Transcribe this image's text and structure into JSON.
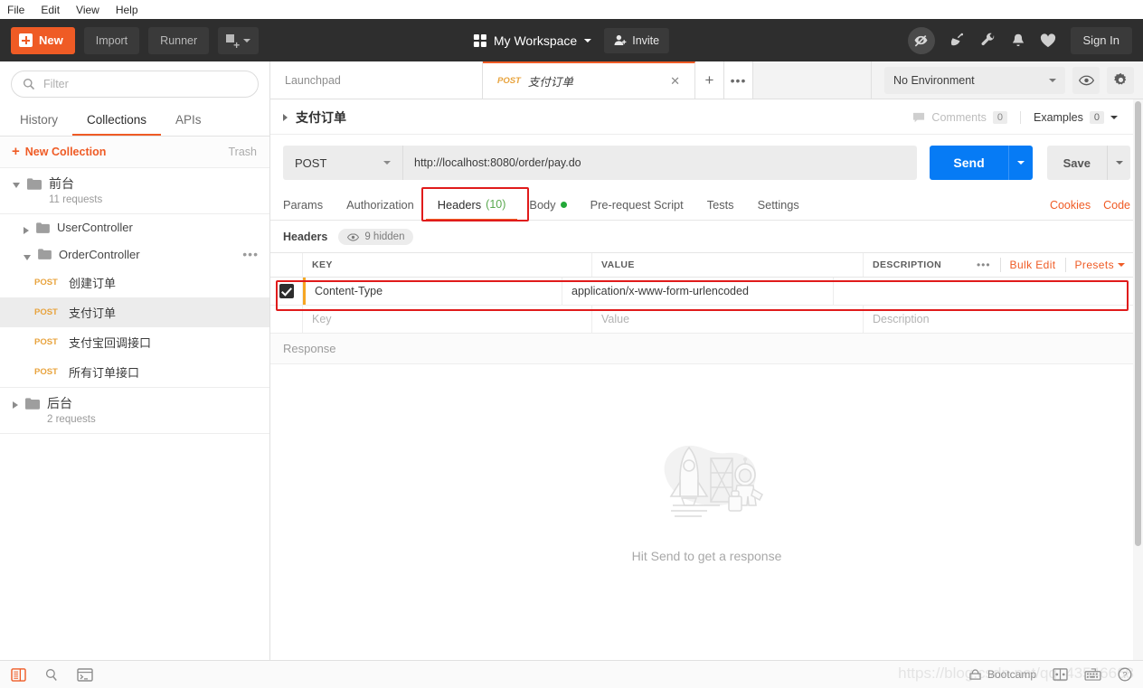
{
  "menubar": {
    "items": [
      "File",
      "Edit",
      "View",
      "Help"
    ]
  },
  "toolbar": {
    "new_label": "New",
    "import_label": "Import",
    "runner_label": "Runner",
    "new_tab_icon": "new-window-icon",
    "workspace_label": "My Workspace",
    "invite_label": "Invite",
    "signin_label": "Sign In",
    "right_icons": [
      "eye-slash-icon",
      "satellite-icon",
      "wrench-icon",
      "bell-icon",
      "heart-icon"
    ],
    "accent_color": "#ef5b25",
    "bg_color": "#2e2e2e"
  },
  "sidebar": {
    "filter_placeholder": "Filter",
    "tabs": [
      {
        "label": "History",
        "active": false
      },
      {
        "label": "Collections",
        "active": true
      },
      {
        "label": "APIs",
        "active": false
      }
    ],
    "new_collection_label": "New Collection",
    "trash_label": "Trash",
    "collections": [
      {
        "name": "前台",
        "subtitle": "11 requests",
        "expanded": true
      },
      {
        "name": "后台",
        "subtitle": "2 requests",
        "expanded": false
      }
    ],
    "folders": [
      {
        "name": "UserController",
        "expanded": false
      },
      {
        "name": "OrderController",
        "expanded": true
      }
    ],
    "requests": [
      {
        "method": "POST",
        "name": "创建订单",
        "selected": false
      },
      {
        "method": "POST",
        "name": "支付订单",
        "selected": true
      },
      {
        "method": "POST",
        "name": "支付宝回调接口",
        "selected": false
      },
      {
        "method": "POST",
        "name": "所有订单接口",
        "selected": false
      }
    ]
  },
  "tabs": {
    "launchpad_label": "Launchpad",
    "active": {
      "method": "POST",
      "name": "支付订单"
    },
    "add_label": "+",
    "more_label": "•••"
  },
  "environment": {
    "selected": "No Environment",
    "eye_icon": "eye-icon",
    "gear_icon": "gear-icon"
  },
  "request": {
    "breadcrumb": "支付订单",
    "comments_label": "Comments",
    "comments_count": "0",
    "examples_label": "Examples",
    "examples_count": "0",
    "method": "POST",
    "url": "http://localhost:8080/order/pay.do",
    "send_label": "Send",
    "save_label": "Save",
    "tabs": [
      {
        "label": "Params",
        "active": false
      },
      {
        "label": "Authorization",
        "active": false
      },
      {
        "label": "Headers",
        "count": "(10)",
        "active": true
      },
      {
        "label": "Body",
        "dot": true,
        "active": false
      },
      {
        "label": "Pre-request Script",
        "active": false
      },
      {
        "label": "Tests",
        "active": false
      },
      {
        "label": "Settings",
        "active": false
      }
    ],
    "cookies_label": "Cookies",
    "code_label": "Code"
  },
  "headers": {
    "section_label": "Headers",
    "hidden_label": "9 hidden",
    "columns": [
      "KEY",
      "VALUE",
      "DESCRIPTION"
    ],
    "bulk_edit_label": "Bulk Edit",
    "presets_label": "Presets",
    "rows": [
      {
        "checked": true,
        "key": "Content-Type",
        "value": "application/x-www-form-urlencoded",
        "description": "",
        "highlighted": true
      }
    ],
    "placeholder_row": {
      "key": "Key",
      "value": "Value",
      "description": "Description"
    }
  },
  "response": {
    "section_label": "Response",
    "empty_message": "Hit Send to get a response"
  },
  "statusbar": {
    "left_icons": [
      "sidebar-toggle-icon",
      "find-icon",
      "console-icon"
    ],
    "bootcamp_label": "Bootcamp",
    "right_icons": [
      "two-pane-icon",
      "keyboard-icon",
      "help-icon"
    ]
  },
  "watermark": "https://blog.csdn.net/qq_43546668"
}
